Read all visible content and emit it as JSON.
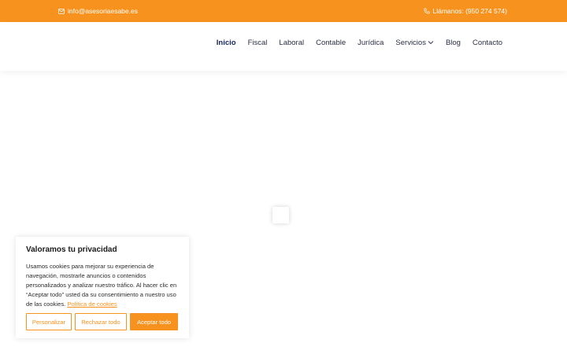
{
  "topbar": {
    "email": "info@asesoriaesabe.es",
    "phone": "Llámanos: (950 274 574)",
    "color": "#f7921e"
  },
  "nav": {
    "items": [
      {
        "label": "Inicio",
        "active": true
      },
      {
        "label": "Fiscal"
      },
      {
        "label": "Laboral"
      },
      {
        "label": "Contable"
      },
      {
        "label": "Jurídica"
      },
      {
        "label": "Servicios",
        "icon": "chevron-down-icon"
      },
      {
        "label": "Blog"
      },
      {
        "label": "Contacto"
      }
    ]
  },
  "cookie": {
    "title": "Valoramos tu privacidad",
    "text": "Usamos cookies para mejorar su experiencia de navegación, mostrarle anuncios o contenidos personalizados y analizar nuestro tráfico. Al hacer clic en “Aceptar todo” usted da su consentimiento a nuestro uso de las cookies.",
    "link": "Política de cookies",
    "buttons": {
      "customize": "Personalizar",
      "reject": "Rechazar todo",
      "accept": "Aceptar todo"
    }
  }
}
